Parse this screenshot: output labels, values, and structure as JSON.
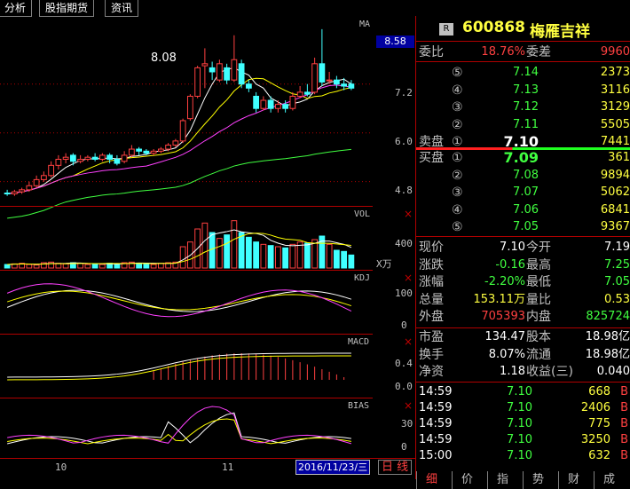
{
  "tabs": [
    "分析",
    "股指期货",
    "资讯"
  ],
  "chart": {
    "indicator_names": {
      "ma": "MA",
      "vol": "VOL",
      "kdj": "KDJ",
      "macd": "MACD",
      "bias": "BIAS"
    },
    "price_axis": [
      "7.2",
      "6.0",
      "4.8"
    ],
    "current_price_box": "8.58",
    "high_label": "8.08",
    "vol_axis": [
      "400"
    ],
    "vol_unit": "X万",
    "kdj_axis": [
      "100",
      "50",
      "0"
    ],
    "macd_axis": [
      "0.4",
      "0.0"
    ],
    "bias_axis": [
      "30",
      "0"
    ],
    "x_labels": [
      "10",
      "11"
    ],
    "date": "2016/11/23/三",
    "period": "日 线",
    "candles": [
      [
        4.52,
        4.5,
        4.6,
        4.45
      ],
      [
        4.5,
        4.55,
        4.6,
        4.45
      ],
      [
        4.55,
        4.6,
        4.65,
        4.5
      ],
      [
        4.6,
        4.7,
        4.8,
        4.55
      ],
      [
        4.7,
        4.85,
        4.95,
        4.65
      ],
      [
        4.85,
        4.95,
        5.05,
        4.8
      ],
      [
        4.95,
        5.2,
        5.3,
        4.9
      ],
      [
        5.2,
        5.35,
        5.45,
        5.1
      ],
      [
        5.35,
        5.4,
        5.5,
        5.25
      ],
      [
        5.45,
        5.3,
        5.5,
        5.2
      ],
      [
        5.3,
        5.35,
        5.45,
        5.25
      ],
      [
        5.35,
        5.4,
        5.45,
        5.3
      ],
      [
        5.4,
        5.35,
        5.5,
        5.3
      ],
      [
        5.35,
        5.45,
        5.5,
        5.3
      ],
      [
        5.45,
        5.35,
        5.5,
        5.25
      ],
      [
        5.35,
        5.25,
        5.45,
        5.2
      ],
      [
        5.3,
        5.45,
        5.55,
        5.25
      ],
      [
        5.45,
        5.6,
        5.7,
        5.4
      ],
      [
        5.6,
        5.55,
        5.65,
        5.45
      ],
      [
        5.55,
        5.5,
        5.6,
        5.45
      ],
      [
        5.5,
        5.55,
        5.6,
        5.45
      ],
      [
        5.55,
        5.6,
        5.65,
        5.5
      ],
      [
        5.6,
        5.7,
        5.75,
        5.55
      ],
      [
        5.7,
        5.8,
        5.85,
        5.65
      ],
      [
        5.8,
        6.3,
        6.35,
        5.75
      ],
      [
        6.35,
        6.9,
        6.95,
        6.3
      ],
      [
        6.9,
        7.6,
        7.65,
        6.85
      ],
      [
        7.65,
        7.7,
        8.08,
        7.1
      ],
      [
        7.6,
        7.5,
        7.75,
        7.3
      ],
      [
        7.3,
        7.7,
        7.8,
        7.25
      ],
      [
        7.6,
        7.3,
        7.7,
        7.2
      ],
      [
        7.3,
        7.8,
        8.4,
        7.25
      ],
      [
        7.7,
        7.2,
        7.8,
        7.1
      ],
      [
        7.2,
        7.1,
        7.3,
        7.0
      ],
      [
        6.9,
        6.6,
        7.0,
        6.5
      ],
      [
        6.6,
        6.8,
        6.9,
        6.55
      ],
      [
        6.8,
        6.6,
        6.9,
        6.5
      ],
      [
        6.6,
        6.7,
        6.8,
        6.5
      ],
      [
        6.7,
        6.6,
        6.8,
        6.5
      ],
      [
        6.6,
        6.9,
        7.0,
        6.55
      ],
      [
        6.9,
        7.0,
        7.15,
        6.85
      ],
      [
        7.0,
        6.95,
        7.2,
        6.9
      ],
      [
        7.0,
        7.7,
        7.85,
        6.95
      ],
      [
        7.7,
        7.25,
        8.55,
        7.15
      ],
      [
        7.3,
        7.3,
        7.5,
        7.2
      ],
      [
        7.3,
        7.2,
        7.4,
        7.1
      ],
      [
        7.2,
        7.15,
        7.35,
        7.05
      ],
      [
        7.2,
        7.1,
        7.3,
        7.05
      ]
    ],
    "volumes": [
      30,
      35,
      40,
      30,
      25,
      45,
      50,
      40,
      35,
      45,
      40,
      30,
      35,
      30,
      40,
      35,
      45,
      50,
      40,
      35,
      30,
      40,
      45,
      50,
      180,
      220,
      330,
      380,
      300,
      250,
      280,
      400,
      300,
      260,
      220,
      200,
      190,
      180,
      170,
      200,
      220,
      210,
      240,
      270,
      200,
      150,
      140,
      110
    ]
  },
  "quote": {
    "badge": "R",
    "code": "600868",
    "name": "梅雁吉祥",
    "weibi_label": "委比",
    "weibi_value": "18.76%",
    "weicha_label": "委差",
    "weicha_value": "9960",
    "sell_label": "卖盘",
    "buy_label": "买盘",
    "asks": [
      {
        "level": "⑤",
        "price": "7.14",
        "vol": "2373"
      },
      {
        "level": "④",
        "price": "7.13",
        "vol": "3116"
      },
      {
        "level": "③",
        "price": "7.12",
        "vol": "3129"
      },
      {
        "level": "②",
        "price": "7.11",
        "vol": "5505"
      },
      {
        "level": "①",
        "price": "7.10",
        "vol": "7441"
      }
    ],
    "bids": [
      {
        "level": "①",
        "price": "7.09",
        "vol": "361"
      },
      {
        "level": "②",
        "price": "7.08",
        "vol": "9894"
      },
      {
        "level": "③",
        "price": "7.07",
        "vol": "5062"
      },
      {
        "level": "④",
        "price": "7.06",
        "vol": "6841"
      },
      {
        "level": "⑤",
        "price": "7.05",
        "vol": "9367"
      }
    ],
    "stats": [
      {
        "l1": "现价",
        "v1": "7.10",
        "l2": "今开",
        "v2": "7.19"
      },
      {
        "l1": "涨跌",
        "v1": "-0.16",
        "l2": "最高",
        "v2": "7.25"
      },
      {
        "l1": "涨幅",
        "v1": "-2.20%",
        "l2": "最低",
        "v2": "7.05"
      },
      {
        "l1": "总量",
        "v1": "153.11万",
        "l2": "量比",
        "v2": "0.53"
      },
      {
        "l1": "外盘",
        "v1": "705393",
        "l2": "内盘",
        "v2": "825724"
      }
    ],
    "fund": [
      {
        "l1": "市盈",
        "v1": "134.47",
        "l2": "股本",
        "v2": "18.98亿"
      },
      {
        "l1": "换手",
        "v1": "8.07%",
        "l2": "流通",
        "v2": "18.98亿"
      },
      {
        "l1": "净资",
        "v1": "1.18",
        "l2": "收益(三)",
        "v2": "0.040"
      }
    ],
    "ticks": [
      {
        "time": "14:59",
        "price": "7.10",
        "vol": "668",
        "side": "B"
      },
      {
        "time": "14:59",
        "price": "7.10",
        "vol": "2406",
        "side": "B"
      },
      {
        "time": "14:59",
        "price": "7.10",
        "vol": "775",
        "side": "B"
      },
      {
        "time": "14:59",
        "price": "7.10",
        "vol": "3250",
        "side": "B"
      },
      {
        "time": "15:00",
        "price": "7.10",
        "vol": "632",
        "side": "B"
      }
    ],
    "bottom_tabs": [
      "细",
      "价",
      "指",
      "势",
      "财",
      "成"
    ]
  },
  "colors": {
    "up": "#ff4040",
    "down": "#40ffff",
    "grid": "#b00000",
    "ma5": "#ffffff",
    "ma10": "#ffff00",
    "ma20": "#ff40ff",
    "ma60": "#40ff40"
  }
}
